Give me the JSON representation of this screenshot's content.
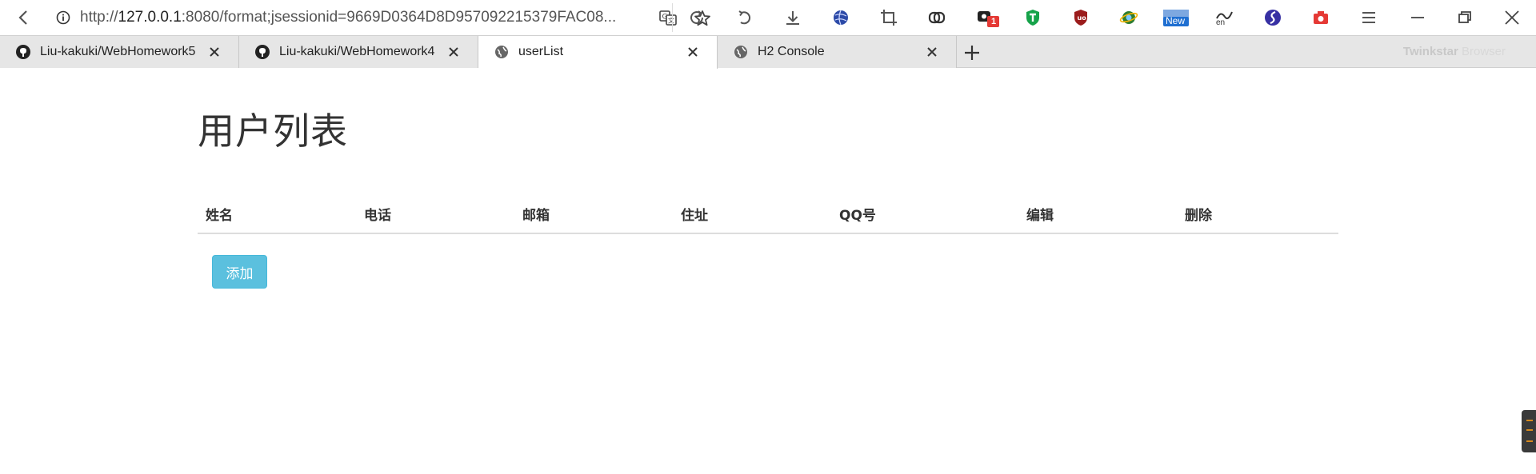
{
  "toolbar": {
    "url_prefix": "http://",
    "url_host": "127.0.0.1",
    "url_rest": ":8080/format;jsessionid=9669D0364D8D957092215379FAC08...",
    "extension_badge": "1",
    "new_badge": "New",
    "lang_label": "en"
  },
  "tabs": [
    {
      "title": "Liu-kakuki/WebHomework5",
      "icon": "github-icon",
      "active": false
    },
    {
      "title": "Liu-kakuki/WebHomework4",
      "icon": "github-icon",
      "active": false
    },
    {
      "title": "userList",
      "icon": "globe-icon",
      "active": true
    },
    {
      "title": "H2 Console",
      "icon": "globe-icon",
      "active": false
    }
  ],
  "brand": {
    "name": "Twinkstar",
    "sub": " Browser"
  },
  "page": {
    "title": "用户列表",
    "table_headers": [
      "姓名",
      "电话",
      "邮箱",
      "住址",
      "QQ号",
      "编辑",
      "删除"
    ],
    "add_button": "添加"
  },
  "colors": {
    "accent": "#5bc0de",
    "accent_border": "#46b8da",
    "tab_strip": "#e6e6e6",
    "text": "#333333"
  }
}
